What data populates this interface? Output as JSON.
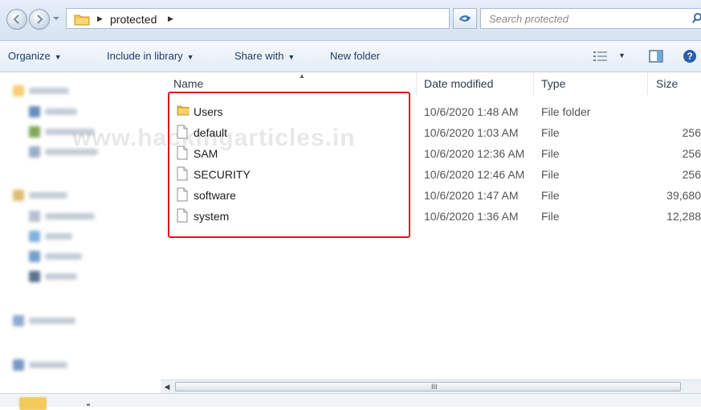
{
  "address": {
    "path_segment": "protected",
    "search_placeholder": "Search protected"
  },
  "toolbar": {
    "organize": "Organize",
    "include_in_library": "Include in library",
    "share_with": "Share with",
    "new_folder": "New folder"
  },
  "watermark": "www.hackingarticles.in",
  "columns": {
    "name": "Name",
    "date_modified": "Date modified",
    "type": "Type",
    "size": "Size"
  },
  "files": [
    {
      "name": "Users",
      "date": "10/6/2020 1:48 AM",
      "type": "File folder",
      "size": "",
      "icon": "folder-icon"
    },
    {
      "name": "default",
      "date": "10/6/2020 1:03 AM",
      "type": "File",
      "size": "256",
      "icon": "file-icon"
    },
    {
      "name": "SAM",
      "date": "10/6/2020 12:36 AM",
      "type": "File",
      "size": "256",
      "icon": "file-icon"
    },
    {
      "name": "SECURITY",
      "date": "10/6/2020 12:46 AM",
      "type": "File",
      "size": "256",
      "icon": "file-icon"
    },
    {
      "name": "software",
      "date": "10/6/2020 1:47 AM",
      "type": "File",
      "size": "39,680",
      "icon": "file-icon"
    },
    {
      "name": "system",
      "date": "10/6/2020 1:36 AM",
      "type": "File",
      "size": "12,288",
      "icon": "file-icon"
    }
  ],
  "scrollbar": {
    "grip": "III"
  },
  "colors": {
    "highlight_border": "#e0141e",
    "folder": "#f3c95a",
    "toolbar_text": "#1e3a5f"
  }
}
